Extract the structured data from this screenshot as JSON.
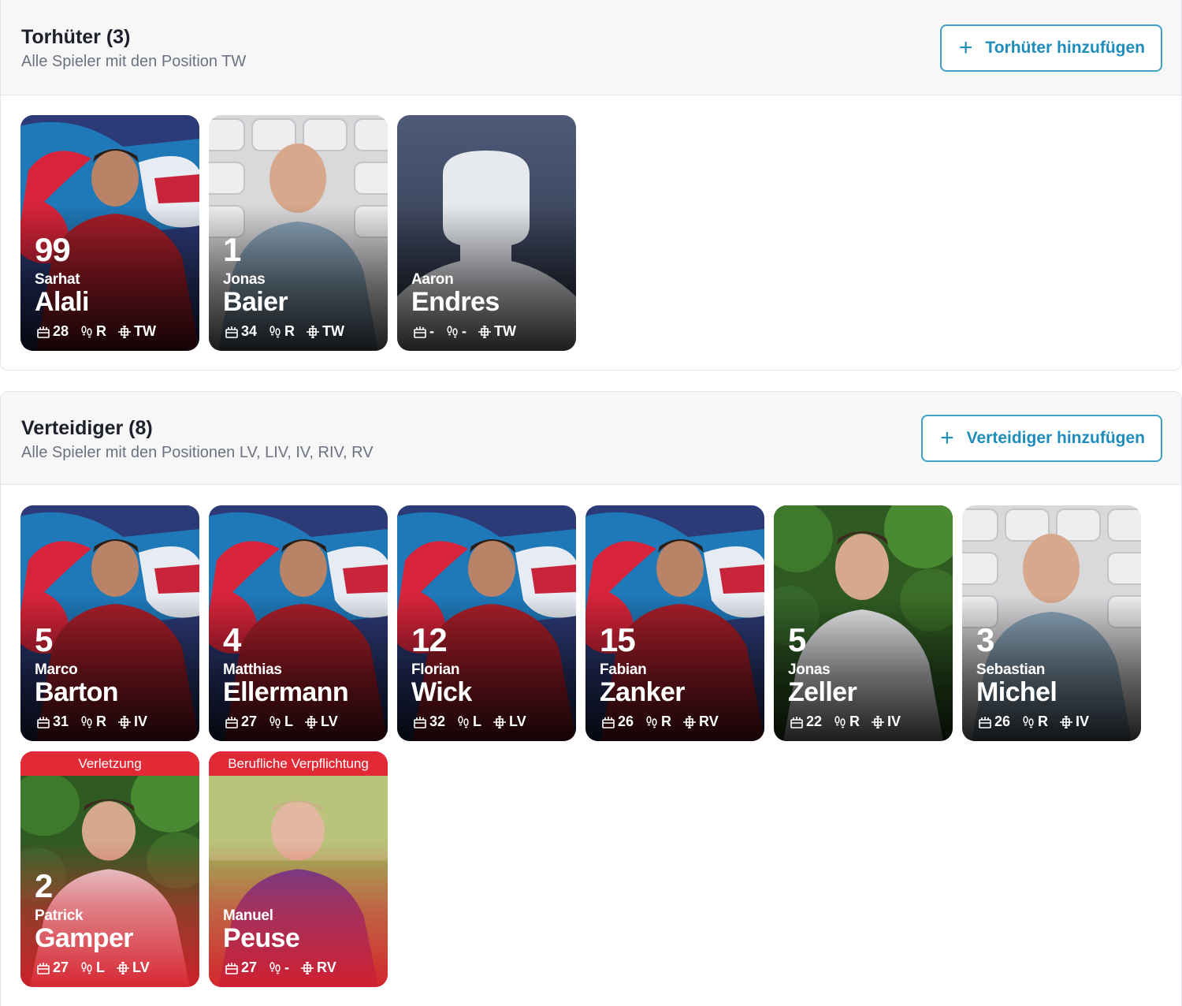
{
  "sections": [
    {
      "title": "Torhüter (3)",
      "subtitle": "Alle Spieler mit den Position TW",
      "add_label": "Torhüter hinzufügen",
      "players": [
        {
          "number": "99",
          "first": "Sarhat",
          "last": "Alali",
          "age": "28",
          "foot": "R",
          "pos": "TW",
          "photo": "graffiti"
        },
        {
          "number": "1",
          "first": "Jonas",
          "last": "Baier",
          "age": "34",
          "foot": "R",
          "pos": "TW",
          "photo": "stands"
        },
        {
          "number": "",
          "first": "Aaron",
          "last": "Endres",
          "age": "-",
          "foot": "-",
          "pos": "TW",
          "photo": "placeholder"
        }
      ]
    },
    {
      "title": "Verteidiger (8)",
      "subtitle": "Alle Spieler mit den Positionen LV, LIV, IV, RIV, RV",
      "add_label": "Verteidiger hinzufügen",
      "players": [
        {
          "number": "5",
          "first": "Marco",
          "last": "Barton",
          "age": "31",
          "foot": "R",
          "pos": "IV",
          "photo": "graffiti"
        },
        {
          "number": "4",
          "first": "Matthias",
          "last": "Ellermann",
          "age": "27",
          "foot": "L",
          "pos": "LV",
          "photo": "graffiti"
        },
        {
          "number": "12",
          "first": "Florian",
          "last": "Wick",
          "age": "32",
          "foot": "L",
          "pos": "LV",
          "photo": "graffiti"
        },
        {
          "number": "15",
          "first": "Fabian",
          "last": "Zanker",
          "age": "26",
          "foot": "R",
          "pos": "RV",
          "photo": "graffiti"
        },
        {
          "number": "5",
          "first": "Jonas",
          "last": "Zeller",
          "age": "22",
          "foot": "R",
          "pos": "IV",
          "photo": "trees"
        },
        {
          "number": "3",
          "first": "Sebastian",
          "last": "Michel",
          "age": "26",
          "foot": "R",
          "pos": "IV",
          "photo": "stands"
        },
        {
          "number": "2",
          "first": "Patrick",
          "last": "Gamper",
          "age": "27",
          "foot": "L",
          "pos": "LV",
          "photo": "trees",
          "status": "Verletzung"
        },
        {
          "number": "",
          "first": "Manuel",
          "last": "Peuse",
          "age": "27",
          "foot": "-",
          "pos": "RV",
          "photo": "field",
          "status": "Berufliche Verpflichtung"
        }
      ]
    }
  ],
  "colors": {
    "accent": "#1f8dbb",
    "unavailable": "#e12a36",
    "placeholder_bg": "#4e5a78"
  },
  "icons": {
    "age": "calendar-cake-icon",
    "foot": "footprints-icon",
    "position": "field-position-icon",
    "add": "plus-icon"
  }
}
